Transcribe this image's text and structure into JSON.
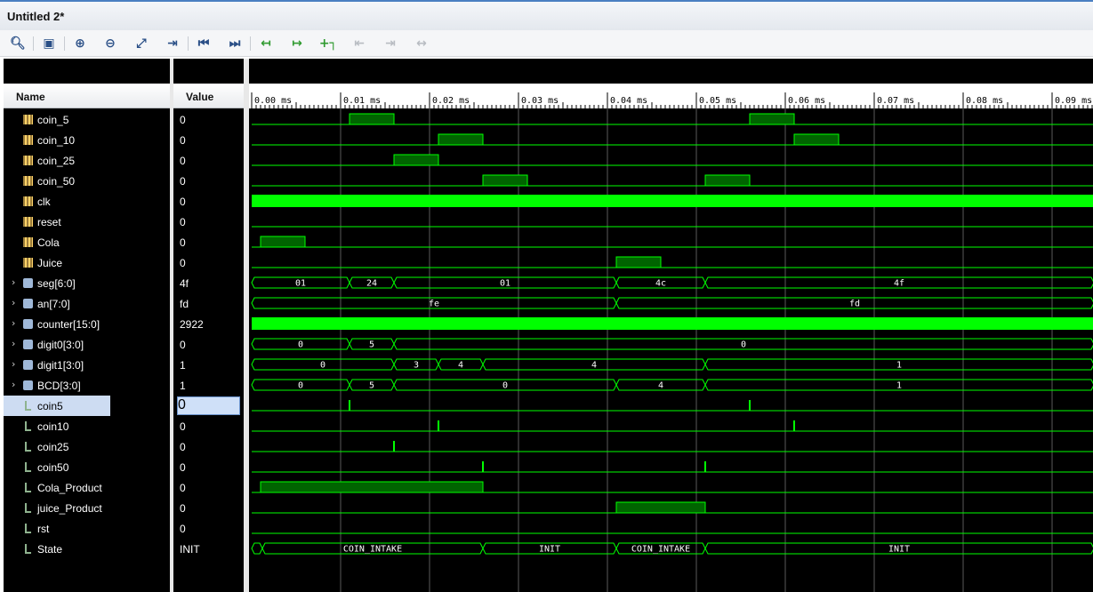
{
  "window": {
    "title": "Untitled 2*"
  },
  "toolbar": {
    "icons": [
      "search-icon",
      "save-icon",
      "zoom-in-icon",
      "zoom-out-icon",
      "zoom-fit-icon",
      "go-to-cursor-icon",
      "go-to-start-icon",
      "go-to-end-icon",
      "previous-transition-icon",
      "next-transition-icon",
      "add-marker-icon",
      "previous-marker-icon",
      "next-marker-icon",
      "swap-cursors-icon"
    ]
  },
  "columns": {
    "name": "Name",
    "value": "Value"
  },
  "timeline": {
    "ticks": [
      "0.00 ms",
      "0.01 ms",
      "0.02 ms",
      "0.03 ms",
      "0.04 ms",
      "0.05 ms",
      "0.06 ms",
      "0.07 ms",
      "0.08 ms",
      "0.09 ms"
    ],
    "max_ms": 0.0947
  },
  "colors": {
    "wave": "#00ff00",
    "wave_fill": "#006400",
    "grid": "#5a5a5a",
    "background": "#000000"
  },
  "signals": [
    {
      "name": "coin_5",
      "value": "0",
      "kind": "port",
      "type": "bit",
      "high": [
        [
          0.011,
          0.016
        ],
        [
          0.056,
          0.061
        ]
      ]
    },
    {
      "name": "coin_10",
      "value": "0",
      "kind": "port",
      "type": "bit",
      "high": [
        [
          0.021,
          0.026
        ],
        [
          0.061,
          0.066
        ]
      ]
    },
    {
      "name": "coin_25",
      "value": "0",
      "kind": "port",
      "type": "bit",
      "high": [
        [
          0.016,
          0.021
        ]
      ]
    },
    {
      "name": "coin_50",
      "value": "0",
      "kind": "port",
      "type": "bit",
      "high": [
        [
          0.026,
          0.031
        ],
        [
          0.051,
          0.056
        ]
      ]
    },
    {
      "name": "clk",
      "value": "0",
      "kind": "port",
      "type": "dense"
    },
    {
      "name": "reset",
      "value": "0",
      "kind": "port",
      "type": "bit",
      "high": []
    },
    {
      "name": "Cola",
      "value": "0",
      "kind": "port",
      "type": "bit",
      "high": [
        [
          0.001,
          0.006
        ]
      ]
    },
    {
      "name": "Juice",
      "value": "0",
      "kind": "port",
      "type": "bit",
      "high": [
        [
          0.041,
          0.046
        ]
      ]
    },
    {
      "name": "seg[6:0]",
      "value": "4f",
      "kind": "bus",
      "expandable": true,
      "type": "bus",
      "segments": [
        {
          "t": [
            0.0,
            0.011
          ],
          "label": "01"
        },
        {
          "t": [
            0.011,
            0.016
          ],
          "label": "24"
        },
        {
          "t": [
            0.016,
            0.041
          ],
          "label": "01"
        },
        {
          "t": [
            0.041,
            0.051
          ],
          "label": "4c"
        },
        {
          "t": [
            0.051,
            0.0947
          ],
          "label": "4f"
        }
      ]
    },
    {
      "name": "an[7:0]",
      "value": "fd",
      "kind": "bus",
      "expandable": true,
      "type": "bus",
      "segments": [
        {
          "t": [
            0.0,
            0.041
          ],
          "label": "fe"
        },
        {
          "t": [
            0.041,
            0.0947
          ],
          "label": "fd"
        }
      ]
    },
    {
      "name": "counter[15:0]",
      "value": "2922",
      "kind": "bus",
      "expandable": true,
      "type": "dense"
    },
    {
      "name": "digit0[3:0]",
      "value": "0",
      "kind": "bus",
      "expandable": true,
      "type": "bus",
      "segments": [
        {
          "t": [
            0.0,
            0.011
          ],
          "label": "0"
        },
        {
          "t": [
            0.011,
            0.016
          ],
          "label": "5"
        },
        {
          "t": [
            0.016,
            0.0947
          ],
          "label": "0"
        }
      ]
    },
    {
      "name": "digit1[3:0]",
      "value": "1",
      "kind": "bus",
      "expandable": true,
      "type": "bus",
      "segments": [
        {
          "t": [
            0.0,
            0.016
          ],
          "label": "0"
        },
        {
          "t": [
            0.016,
            0.021
          ],
          "label": "3"
        },
        {
          "t": [
            0.021,
            0.026
          ],
          "label": "4"
        },
        {
          "t": [
            0.026,
            0.051
          ],
          "label": "4"
        },
        {
          "t": [
            0.051,
            0.0947
          ],
          "label": "1"
        }
      ]
    },
    {
      "name": "BCD[3:0]",
      "value": "1",
      "kind": "bus",
      "expandable": true,
      "type": "bus",
      "segments": [
        {
          "t": [
            0.0,
            0.011
          ],
          "label": "0"
        },
        {
          "t": [
            0.011,
            0.016
          ],
          "label": "5"
        },
        {
          "t": [
            0.016,
            0.041
          ],
          "label": "0"
        },
        {
          "t": [
            0.041,
            0.051
          ],
          "label": "4"
        },
        {
          "t": [
            0.051,
            0.0947
          ],
          "label": "1"
        }
      ]
    },
    {
      "name": "coin5",
      "value": "0",
      "kind": "sig",
      "selected": true,
      "type": "pulse",
      "pulses": [
        0.011,
        0.056
      ]
    },
    {
      "name": "coin10",
      "value": "0",
      "kind": "sig",
      "type": "pulse",
      "pulses": [
        0.021,
        0.061
      ]
    },
    {
      "name": "coin25",
      "value": "0",
      "kind": "sig",
      "type": "pulse",
      "pulses": [
        0.016
      ]
    },
    {
      "name": "coin50",
      "value": "0",
      "kind": "sig",
      "type": "pulse",
      "pulses": [
        0.026,
        0.051
      ]
    },
    {
      "name": "Cola_Product",
      "value": "0",
      "kind": "sig",
      "type": "bit",
      "high": [
        [
          0.001,
          0.026
        ]
      ]
    },
    {
      "name": "juice_Product",
      "value": "0",
      "kind": "sig",
      "type": "bit",
      "high": [
        [
          0.041,
          0.051
        ]
      ]
    },
    {
      "name": "rst",
      "value": "0",
      "kind": "sig",
      "type": "bit",
      "high": []
    },
    {
      "name": "State",
      "value": "INIT",
      "kind": "sig",
      "type": "bus",
      "segments": [
        {
          "t": [
            0.0,
            0.0012
          ],
          "label": ""
        },
        {
          "t": [
            0.0012,
            0.026
          ],
          "label": "COIN_INTAKE"
        },
        {
          "t": [
            0.026,
            0.041
          ],
          "label": "INIT"
        },
        {
          "t": [
            0.041,
            0.051
          ],
          "label": "COIN_INTAKE"
        },
        {
          "t": [
            0.051,
            0.0947
          ],
          "label": "INIT"
        }
      ]
    }
  ]
}
